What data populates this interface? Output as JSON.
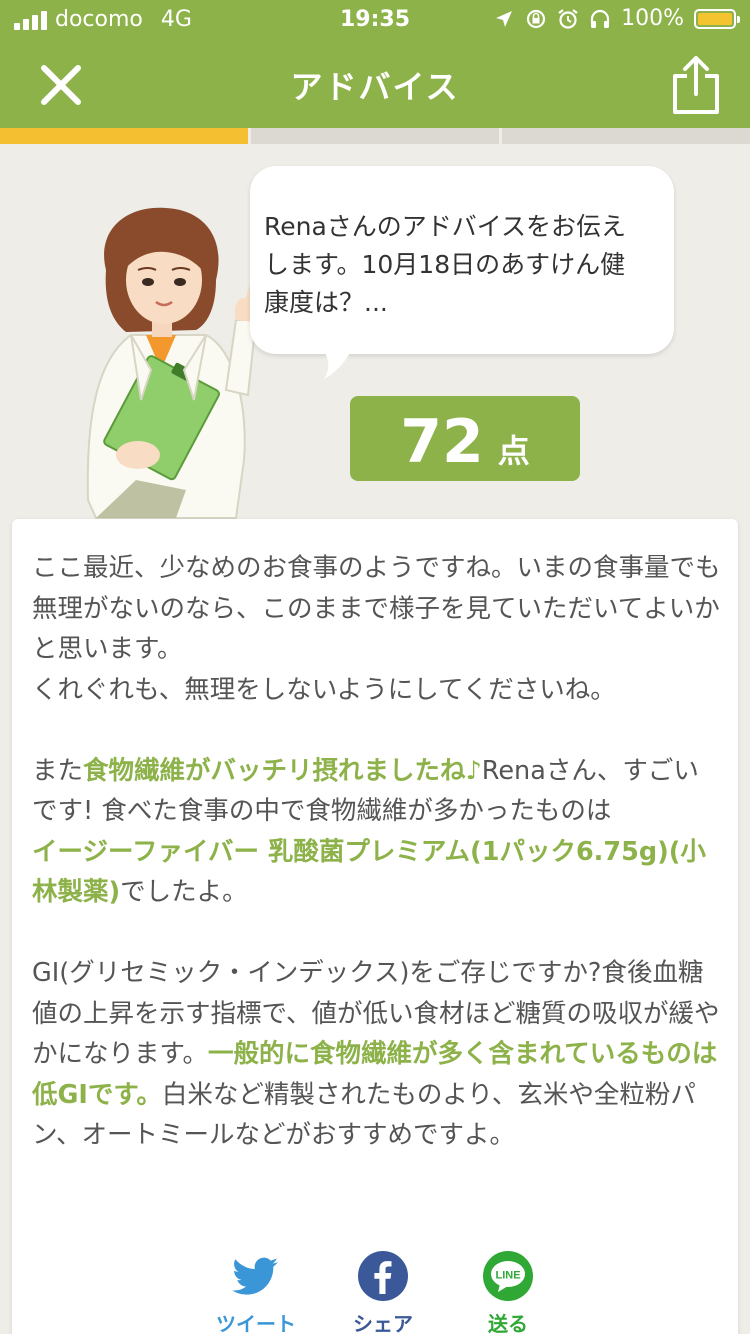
{
  "status_bar": {
    "carrier": "docomo",
    "network": "4G",
    "time": "19:35",
    "battery": "100%",
    "icons": [
      "location-icon",
      "rotation-lock-icon",
      "alarm-icon",
      "headphones-icon"
    ]
  },
  "nav": {
    "title": "アドバイス",
    "close_icon": "close-icon",
    "share_icon": "share-icon"
  },
  "progress": {
    "segments": 3,
    "active_index": 0
  },
  "advisor": {
    "bubble_text": "Renaさんのアドバイスをお伝えします。10月18日のあすけん健康度は？..."
  },
  "score": {
    "value": "72",
    "unit": "点"
  },
  "advice": {
    "p1": "ここ最近、少なめのお食事のようですね。いまの食事量でも無理がないのなら、このままで様子を見ていただいてよいかと思います。",
    "p1b": "くれぐれも、無理をしないようにしてくださいね。",
    "p2_a": "また",
    "p2_hl1": "食物繊維がバッチリ摂れましたね♪",
    "p2_b": "Renaさん、すごいです! 食べた食事の中で食物繊維が多かったものは",
    "p2_hl2": "イージーファイバー 乳酸菌プレミアム(1パック6.75g)(小林製薬)",
    "p2_c": "でしたよ。",
    "p3_a": "GI(グリセミック・インデックス)をご存じですか?食後血糖値の上昇を示す指標で、値が低い食材ほど糖質の吸収が緩やかになります。",
    "p3_hl": "一般的に食物繊維が多く含まれているものは低GIです。",
    "p3_b": "白米など精製されたものより、玄米や全粒粉パン、オートミールなどがおすすめですよ。"
  },
  "share": {
    "twitter": "ツイート",
    "facebook": "シェア",
    "line": "送る",
    "line_icon_text": "LINE"
  },
  "colors": {
    "brand_green": "#8db24a",
    "progress_yellow": "#f5bf32",
    "background": "#efede8"
  }
}
